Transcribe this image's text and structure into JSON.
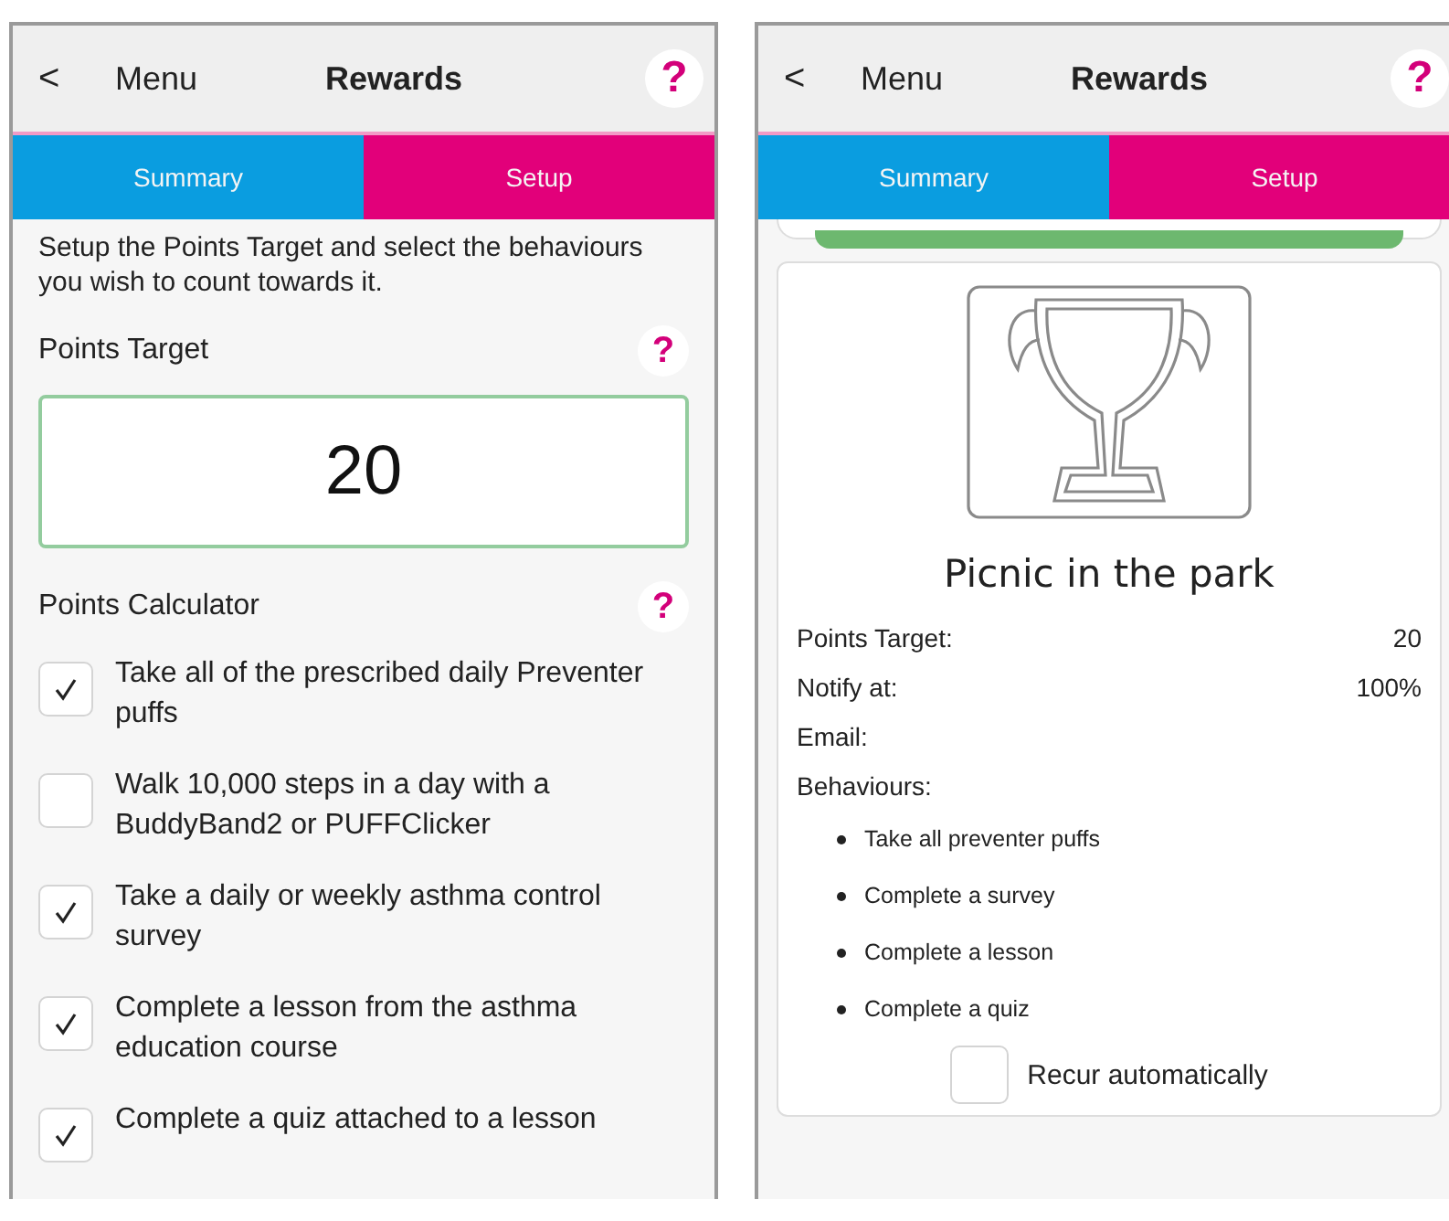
{
  "panels": [
    {
      "header": {
        "back": "<",
        "menu": "Menu",
        "title": "Rewards",
        "help": "?"
      },
      "tabs": [
        {
          "label": "Summary",
          "color": "#0a9de0"
        },
        {
          "label": "Setup",
          "color": "#e2007a"
        }
      ],
      "setup": {
        "intro": "Setup the Points Target and select the behaviours you wish to count towards it.",
        "points_target": {
          "label": "Points Target",
          "help": "?",
          "value": "20"
        },
        "calculator": {
          "label": "Points Calculator",
          "help": "?",
          "items": [
            {
              "text": "Take all of the prescribed daily Preventer puffs",
              "checked": true
            },
            {
              "text": "Walk 10,000 steps in a day with a BuddyBand2 or PUFFClicker",
              "checked": false
            },
            {
              "text": "Take a daily or weekly asthma control survey",
              "checked": true
            },
            {
              "text": "Complete a lesson from the asthma education course",
              "checked": true
            },
            {
              "text": "Complete a quiz attached to a lesson",
              "checked": true
            }
          ]
        }
      }
    },
    {
      "header": {
        "back": "<",
        "menu": "Menu",
        "title": "Rewards",
        "help": "?"
      },
      "tabs": [
        {
          "label": "Summary",
          "color": "#0a9de0"
        },
        {
          "label": "Setup",
          "color": "#e2007a"
        }
      ],
      "summary": {
        "title": "Picnic in the park",
        "details": [
          {
            "label": "Points Target:",
            "value": "20"
          },
          {
            "label": "Notify at:",
            "value": "100%"
          },
          {
            "label": "Email:"
          },
          {
            "label": "Behaviours:"
          }
        ],
        "behaviours": [
          "Take all preventer puffs",
          "Complete a survey",
          "Complete a lesson",
          "Complete a quiz"
        ],
        "recur": {
          "label": "Recur automatically",
          "checked": false
        }
      }
    }
  ]
}
